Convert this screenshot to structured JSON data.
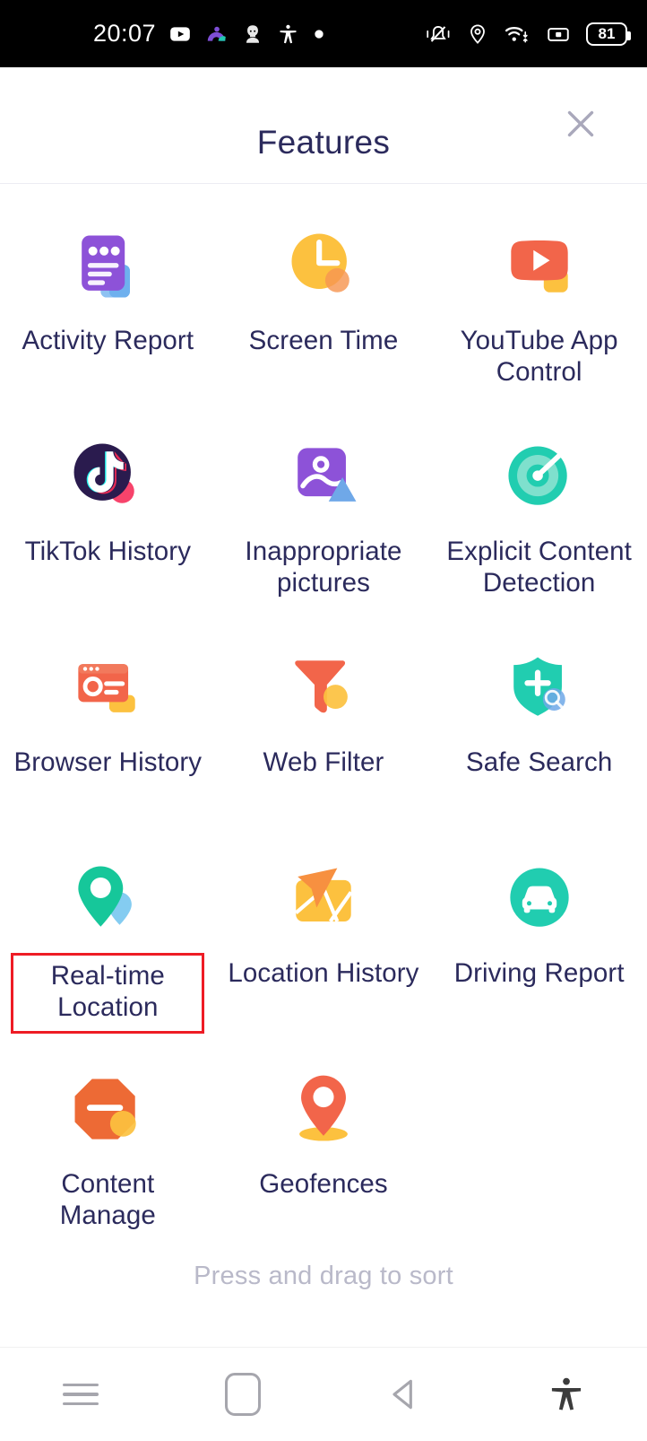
{
  "status_bar": {
    "time": "20:07",
    "battery_level": "81",
    "left_icons": [
      "youtube-play-icon",
      "arch-app-icon",
      "avatar-notification-icon",
      "accessibility-icon",
      "dot-icon"
    ],
    "right_icons": [
      "vibrate-mute-icon",
      "location-pin-icon",
      "wifi-icon",
      "sim-card-icon",
      "battery-icon"
    ]
  },
  "header": {
    "title": "Features",
    "close_icon": "close-icon"
  },
  "features": [
    {
      "label": "Activity Report",
      "icon": "activity-report-icon",
      "highlighted": false
    },
    {
      "label": "Screen Time",
      "icon": "screen-time-icon",
      "highlighted": false
    },
    {
      "label": "YouTube App Control",
      "icon": "youtube-app-control-icon",
      "highlighted": false
    },
    {
      "label": "TikTok History",
      "icon": "tiktok-history-icon",
      "highlighted": false
    },
    {
      "label": "Inappropriate pictures",
      "icon": "inappropriate-pictures-icon",
      "highlighted": false
    },
    {
      "label": "Explicit Content Detection",
      "icon": "explicit-content-icon",
      "highlighted": false
    },
    {
      "label": "Browser History",
      "icon": "browser-history-icon",
      "highlighted": false
    },
    {
      "label": "Web Filter",
      "icon": "web-filter-icon",
      "highlighted": false
    },
    {
      "label": "Safe Search",
      "icon": "safe-search-icon",
      "highlighted": false
    },
    {
      "label": "Real-time Location",
      "icon": "realtime-location-icon",
      "highlighted": true
    },
    {
      "label": "Location History",
      "icon": "location-history-icon",
      "highlighted": false
    },
    {
      "label": "Driving Report",
      "icon": "driving-report-icon",
      "highlighted": false
    },
    {
      "label": "Content Manage",
      "icon": "content-manage-icon",
      "highlighted": false
    },
    {
      "label": "Geofences",
      "icon": "geofences-icon",
      "highlighted": false
    }
  ],
  "footer": {
    "hint": "Press and drag to sort"
  },
  "nav_bar": {
    "items": [
      "recents-menu-icon",
      "home-icon",
      "back-icon",
      "accessibility-icon"
    ]
  },
  "colors": {
    "label_text": "#2b2a5c",
    "hint_text": "#b9b9c9",
    "highlight_box": "#ee1c25",
    "purple": "#8d52d8",
    "amber": "#fcc councils"
  }
}
